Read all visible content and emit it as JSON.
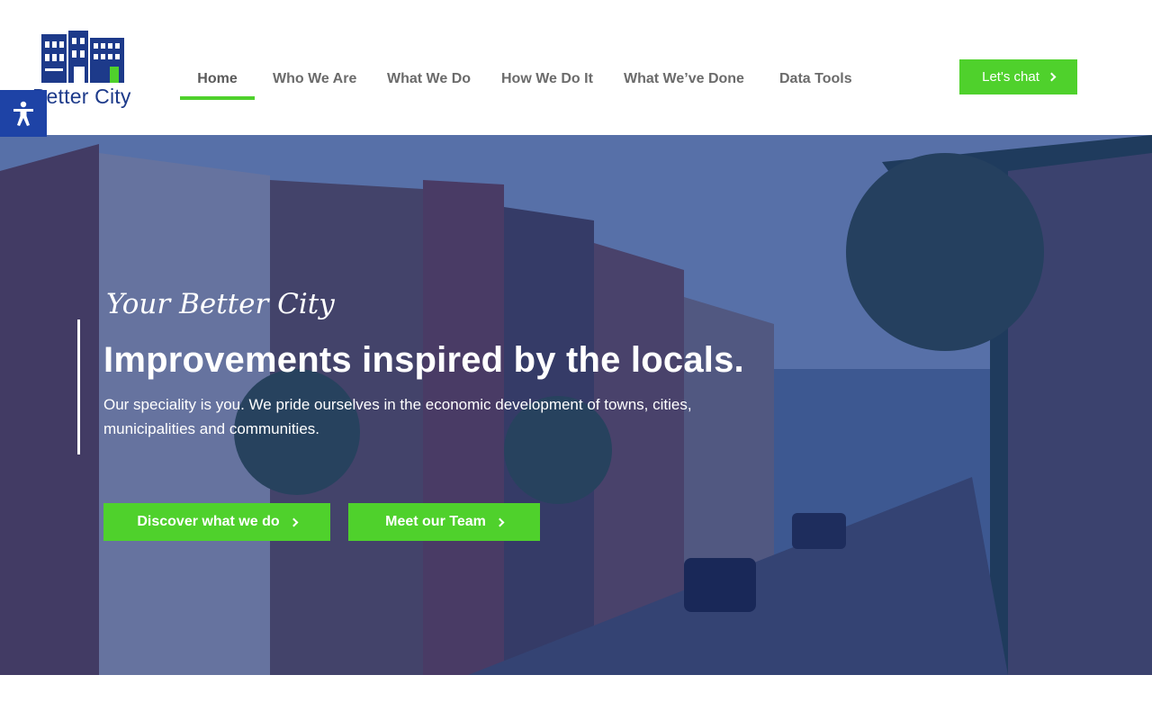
{
  "brand": {
    "name": "Better City"
  },
  "nav": {
    "items": [
      {
        "label": "Home",
        "active": true
      },
      {
        "label": "Who We Are"
      },
      {
        "label": "What We Do"
      },
      {
        "label": "How We Do It"
      },
      {
        "label": "What We’ve Done"
      },
      {
        "label": "Data Tools"
      }
    ]
  },
  "header": {
    "cta_label": "Let's chat"
  },
  "accessibility": {
    "icon": "accessibility-icon"
  },
  "hero": {
    "eyebrow": "Your Better City",
    "title": "Improvements inspired by the locals.",
    "subtitle": "Our speciality is you. We pride ourselves in the economic development of towns, cities, municipalities and communities.",
    "buttons": [
      {
        "label": "Discover what we do"
      },
      {
        "label": "Meet our Team"
      }
    ]
  },
  "colors": {
    "accent_green": "#4fd12c",
    "brand_blue": "#1d3a8a",
    "overlay_blue": "#143087"
  }
}
